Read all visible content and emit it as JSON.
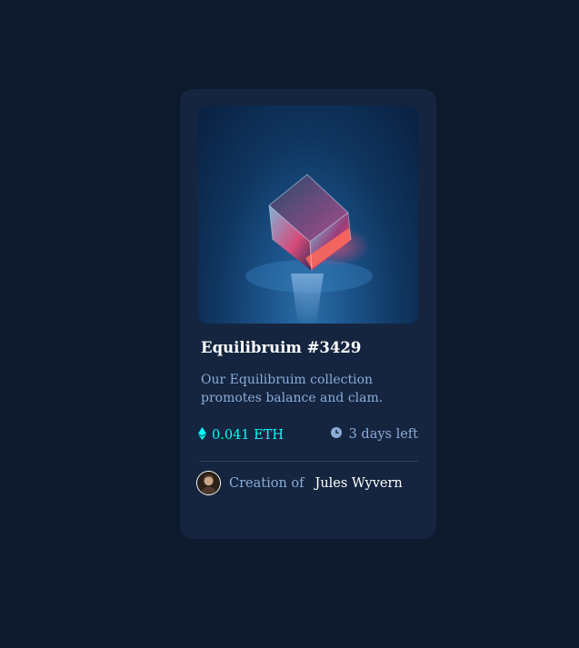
{
  "card": {
    "image_alt": "Equilibrium cube",
    "title": "Equilibruim #3429",
    "description": "Our Equilibruim collection promotes balance and clam.",
    "price": "0.041 ETH",
    "time_left": "3 days left",
    "creator_prefix": "Creation of",
    "creator_name": "Jules Wyvern"
  },
  "icons": {
    "price": "ethereum-icon",
    "time": "clock-icon"
  },
  "colors": {
    "page_bg": "#0d192c",
    "card_bg": "#15253f",
    "accent_cyan": "#00fff8",
    "soft_blue": "#8bacd9",
    "white": "#ffffff"
  }
}
